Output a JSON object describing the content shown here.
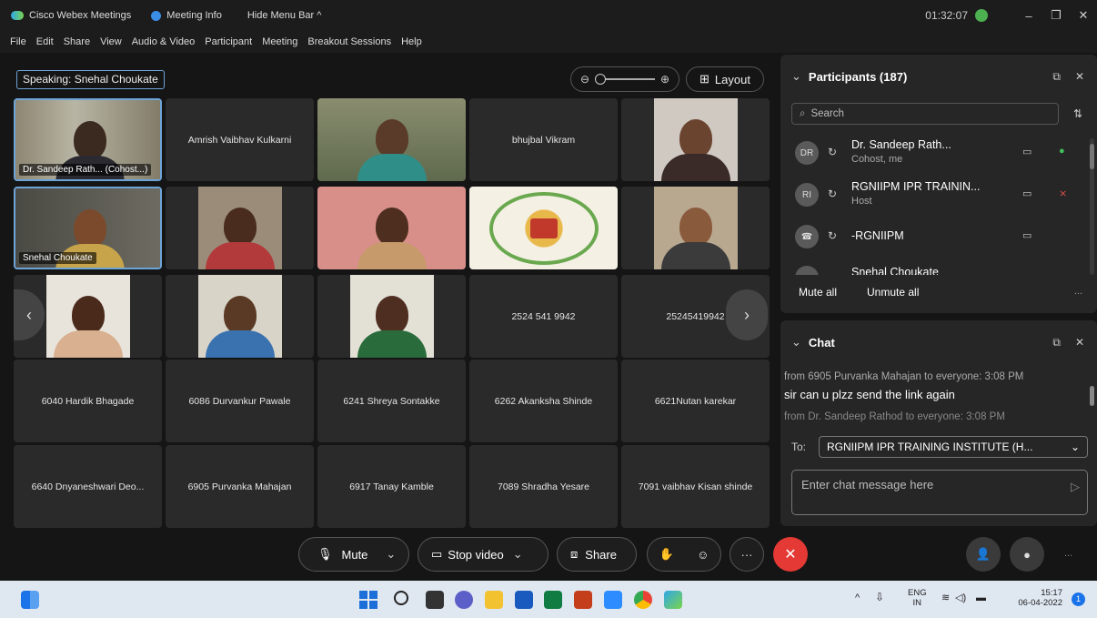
{
  "titlebar": {
    "app_name": "Cisco Webex Meetings",
    "meeting_info": "Meeting Info",
    "hide_menu": "Hide Menu Bar ^",
    "timer": "01:32:07",
    "minimize": "–",
    "restore": "❐",
    "close": "✕"
  },
  "menu": [
    "File",
    "Edit",
    "Share",
    "View",
    "Audio & Video",
    "Participant",
    "Meeting",
    "Breakout Sessions",
    "Help"
  ],
  "speaking": "Speaking: Snehal Choukate",
  "layout_label": "Layout",
  "tiles": {
    "t1": "Dr. Sandeep Rath... (Cohost...)",
    "t2": "Amrish Vaibhav Kulkarni",
    "t4": "bhujbal Vikram",
    "t6": "Snehal Choukate",
    "t14": "2524 541 9942",
    "t15": "25245419942",
    "t16": "6040 Hardik Bhagade",
    "t17": "6086 Durvankur Pawale",
    "t18": "6241 Shreya Sontakke",
    "t19": "6262 Akanksha Shinde",
    "t20": "6621Nutan karekar",
    "t21": "6640 Dnyaneshwari Deo...",
    "t22": "6905 Purvanka Mahajan",
    "t23": "6917 Tanay Kamble",
    "t24": "7089 Shradha Yesare",
    "t25": "7091 vaibhav Kisan shinde"
  },
  "participants": {
    "title": "Participants (187)",
    "search_placeholder": "Search",
    "rows": [
      {
        "initials": "DR",
        "name": "Dr. Sandeep Rath...",
        "role": "Cohost, me"
      },
      {
        "initials": "RI",
        "name": "RGNIIPM IPR TRAININ...",
        "role": "Host"
      },
      {
        "initials": "",
        "name": "-RGNIIPM",
        "role": ""
      },
      {
        "initials": "",
        "name": "Snehal Choukate",
        "role": ""
      }
    ],
    "mute_all": "Mute all",
    "unmute_all": "Unmute all",
    "more": "..."
  },
  "chat": {
    "title": "Chat",
    "msg1_header": "from 6905 Purvanka Mahajan to everyone:   3:08 PM",
    "msg1_text": "sir can u plzz send the link again",
    "msg2_header": "from Dr. Sandeep Rathod to everyone:   3:08 PM",
    "to_label": "To:",
    "to_value": "RGNIIPM IPR TRAINING INSTITUTE (H...",
    "input_placeholder": "Enter chat message here"
  },
  "controls": {
    "mute": "Mute",
    "stop_video": "Stop video",
    "share": "Share",
    "more": "···"
  },
  "taskbar": {
    "lang_top": "ENG",
    "lang_bottom": "IN",
    "time": "15:17",
    "date": "06-04-2022",
    "notif": "1"
  },
  "colors": {
    "accent": "#6da4d8",
    "end": "#e53935",
    "background": "#151515",
    "panel": "#262626"
  }
}
